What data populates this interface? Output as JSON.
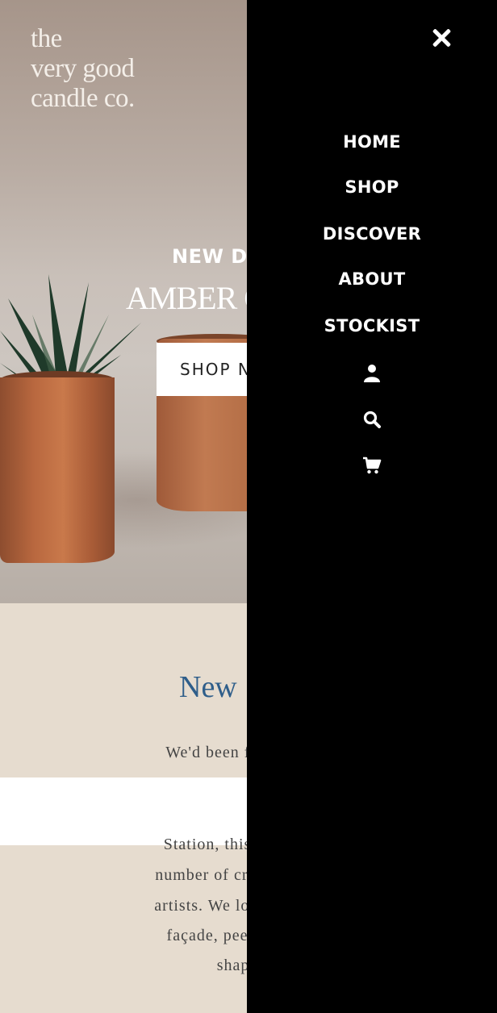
{
  "brand": {
    "logo_lines": [
      "the",
      "very good",
      "candle co."
    ]
  },
  "hero": {
    "subtitle": "NEW D",
    "title": "AMBER C",
    "button_label": "SHOP N"
  },
  "content": {
    "section_title": "New",
    "paragraph_lines": [
      "We'd been fascinated b",
      "Station, this peculiar vi",
      "number of creatives, danc",
      "artists. We love walking b",
      "façade, peering in thro",
      "shaped v"
    ]
  },
  "menu": {
    "items": [
      "HOME",
      "SHOP",
      "DISCOVER",
      "ABOUT",
      "STOCKIST"
    ],
    "icons": [
      "close-icon",
      "user-icon",
      "search-icon",
      "cart-icon"
    ]
  },
  "colors": {
    "menu_bg": "#000000",
    "section_bg": "#e6dccf",
    "title_blue": "#2f5e8a"
  }
}
